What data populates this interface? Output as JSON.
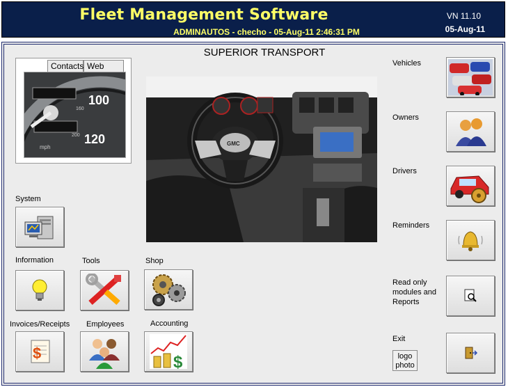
{
  "header": {
    "title": "Fleet Management Software",
    "subtitle": "ADMINAUTOS - checho - 05-Aug-11 2:46:31 PM",
    "version": "VN 11.10",
    "date": "05-Aug-11"
  },
  "company": "SUPERIOR TRANSPORT",
  "tabs": {
    "contacts": "Contacts",
    "websites": "Web sites"
  },
  "left_buttons": {
    "system": "System",
    "information": "Information",
    "tools": "Tools",
    "shop": "Shop",
    "invoices": "Invoices/Receipts",
    "employees": "Employees",
    "accounting": "Accounting"
  },
  "right_buttons": {
    "vehicles": "Vehicles",
    "owners": "Owners",
    "drivers": "Drivers",
    "reminders": "Reminders",
    "readonly_l1": "Read only",
    "readonly_l2": "modules and",
    "readonly_l3": "Reports",
    "exit": "Exit",
    "logo_l1": "logo",
    "logo_l2": "photo"
  },
  "colors": {
    "header_bg": "#0a1f4a",
    "header_title": "#ffff66",
    "frame_border": "#1f2b6e",
    "panel_bg": "#ececec"
  }
}
